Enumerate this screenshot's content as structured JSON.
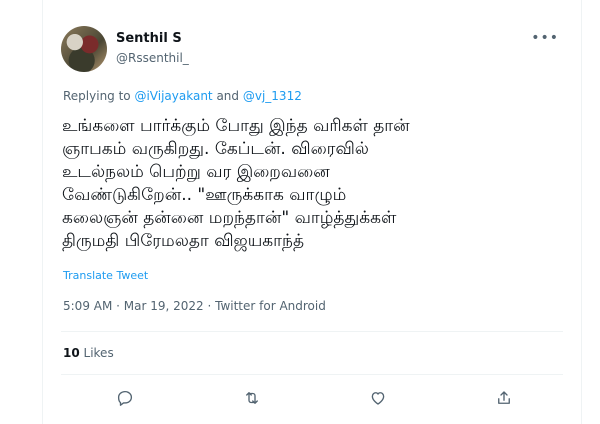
{
  "author": {
    "name": "Senthil S",
    "handle": "@Rssenthil_"
  },
  "reply": {
    "prefix": "Replying to ",
    "mention1": "@iVijayakant",
    "joiner": " and ",
    "mention2": "@vj_1312"
  },
  "tweet": {
    "text": "உங்களை பார்க்கும் போது இந்த வரிகள் தான்\nஞாபகம் வருகிறது. கேப்டன். விரைவில்\nஉடல்நலம் பெற்று வர இறைவனை\nவேண்டுகிறேன்.. \"ஊருக்காக வாழும்\nகலைஞன் தன்னை மறந்தான்\" வாழ்த்துக்கள்\nதிருமதி பிரேமலதா விஜயகாந்த்",
    "translate_label": "Translate Tweet",
    "meta": "5:09 AM · Mar 19, 2022 · Twitter for Android"
  },
  "stats": {
    "likes_count": "10",
    "likes_label": " Likes"
  },
  "icons": {
    "more": "more-icon",
    "reply": "reply-icon",
    "retweet": "retweet-icon",
    "like": "like-icon",
    "share": "share-icon"
  },
  "colors": {
    "accent": "#1d9bf0",
    "secondary_text": "#536471",
    "primary_text": "#0f1419"
  }
}
